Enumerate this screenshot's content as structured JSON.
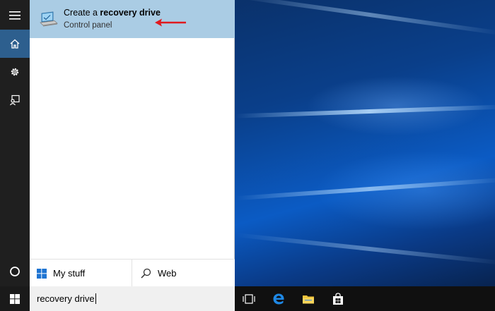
{
  "result": {
    "title_prefix": "Create a ",
    "title_bold": "recovery drive",
    "subtitle": "Control panel",
    "icon": "recovery-drive-icon"
  },
  "filters": {
    "my_stuff": "My stuff",
    "web": "Web"
  },
  "search": {
    "value": "recovery drive"
  },
  "rail": {
    "items": [
      "hamburger-menu-icon",
      "home-icon",
      "settings-gear-icon",
      "feedback-icon",
      "cortana-circle-icon"
    ]
  },
  "taskbar": {
    "icons": [
      "windows-start-icon",
      "task-view-icon",
      "edge-browser-icon",
      "file-explorer-icon",
      "store-icon"
    ]
  },
  "colors": {
    "highlight": "#aacce4",
    "rail_bg": "#1f1f1f",
    "rail_active": "#2d5f8e",
    "annotation_arrow": "#e0191e",
    "accent_blue": "#1e88e5"
  }
}
